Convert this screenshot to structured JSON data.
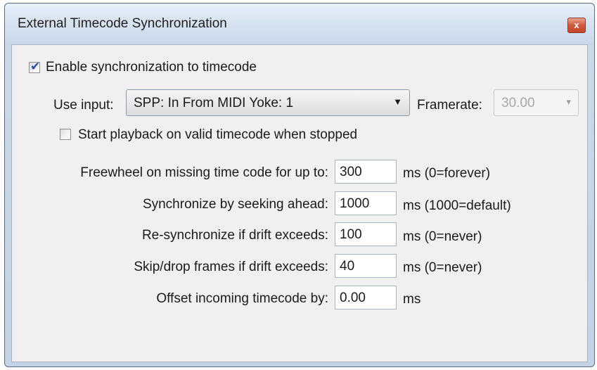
{
  "dialog": {
    "title": "External Timecode Synchronization",
    "close_label": "x"
  },
  "enable_sync": {
    "label": "Enable synchronization to timecode",
    "checked": true
  },
  "input": {
    "label": "Use input:",
    "value": "SPP: In From MIDI Yoke:  1"
  },
  "framerate": {
    "label": "Framerate:",
    "value": "30.00",
    "enabled": false
  },
  "start_playback": {
    "label": "Start playback on valid timecode when stopped",
    "checked": false
  },
  "fields": [
    {
      "label": "Freewheel on missing time code for up to:",
      "value": "300",
      "unit": "ms (0=forever)"
    },
    {
      "label": "Synchronize by seeking ahead:",
      "value": "1000",
      "unit": "ms (1000=default)"
    },
    {
      "label": "Re-synchronize if drift exceeds:",
      "value": "100",
      "unit": "ms (0=never)"
    },
    {
      "label": "Skip/drop frames if drift exceeds:",
      "value": "40",
      "unit": "ms (0=never)"
    },
    {
      "label": "Offset incoming timecode by:",
      "value": "0.00",
      "unit": "ms"
    }
  ],
  "icons": {
    "close": "close-icon",
    "checkmark": "checkmark-icon",
    "dropdown": "chevron-down-icon"
  }
}
